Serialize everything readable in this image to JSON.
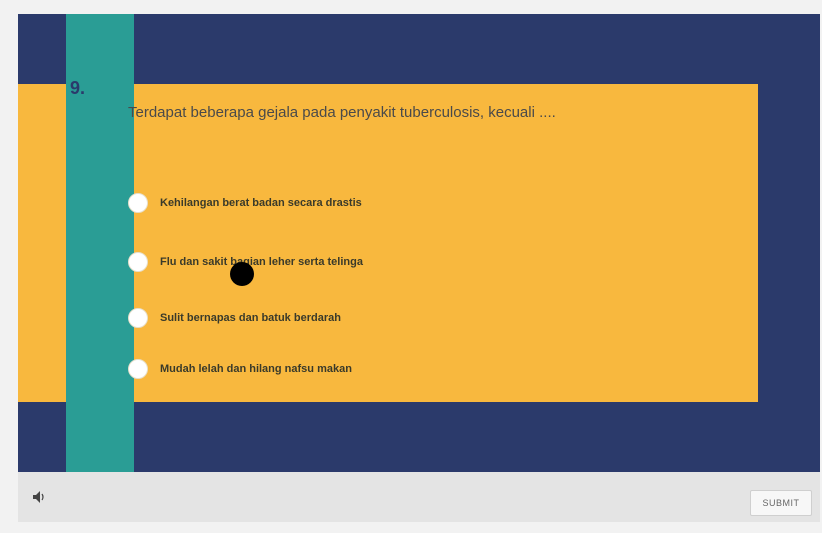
{
  "question": {
    "number": "9.",
    "text": "Terdapat beberapa gejala pada penyakit tuberculosis, kecuali ....",
    "options": [
      {
        "label": "Kehilangan berat badan secara drastis"
      },
      {
        "label": "Flu dan sakit bagian leher serta telinga"
      },
      {
        "label": "Sulit bernapas dan batuk berdarah"
      },
      {
        "label": "Mudah lelah dan hilang nafsu makan"
      }
    ]
  },
  "controls": {
    "audio_icon": "speaker-icon",
    "submit_label": "SUBMIT"
  },
  "colors": {
    "frame": "#2b3a6b",
    "teal": "#2a9d95",
    "panel": "#f8b83e"
  }
}
